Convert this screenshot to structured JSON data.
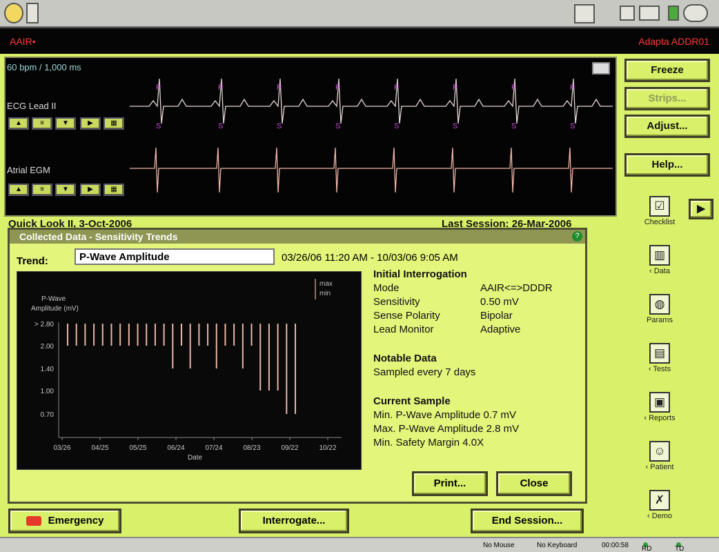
{
  "titlebar": {
    "left": "AAIR•",
    "right": "Adapta ADDR01"
  },
  "ecg": {
    "rate_label": "60 bpm / 1,000 ms",
    "lead1_label": "ECG Lead II",
    "lead2_label": "Atrial EGM",
    "ps_marks": 8
  },
  "controls": {
    "up": "▲",
    "scale": "≡",
    "down": "▼",
    "play": "▶",
    "grid": "▦"
  },
  "side_buttons": {
    "freeze": "Freeze",
    "strips": "Strips...",
    "adjust": "Adjust...",
    "help": "Help..."
  },
  "tools": [
    {
      "label": "Checklist",
      "icon": "checklist-icon",
      "glyph": "☑"
    },
    {
      "label": "‹ Data",
      "icon": "data-icon",
      "glyph": "▥"
    },
    {
      "label": "Params",
      "icon": "params-icon",
      "glyph": "◍"
    },
    {
      "label": "‹ Tests",
      "icon": "tests-icon",
      "glyph": "▤"
    },
    {
      "label": "‹ Reports",
      "icon": "reports-icon",
      "glyph": "▣"
    },
    {
      "label": "‹ Patient",
      "icon": "patient-icon",
      "glyph": "☺"
    },
    {
      "label": "‹ Demo",
      "icon": "demo-icon",
      "glyph": "✗"
    }
  ],
  "arrow_button": "▶",
  "obscured": {
    "left": "Quick Look II, 3-Oct-2006",
    "right": "Last Session: 26-Mar-2006"
  },
  "dialog": {
    "title": "Collected Data - Sensitivity Trends",
    "help": "?",
    "trend_label": "Trend:",
    "trend_value": "P-Wave Amplitude",
    "range": "03/26/06 11:20 AM - 10/03/06 9:05 AM",
    "initial_interrogation": {
      "heading": "Initial Interrogation",
      "rows": [
        {
          "k": "Mode",
          "v": "AAIR<=>DDDR"
        },
        {
          "k": "Sensitivity",
          "v": "0.50 mV"
        },
        {
          "k": "Sense Polarity",
          "v": "Bipolar"
        },
        {
          "k": "Lead Monitor",
          "v": "Adaptive"
        }
      ]
    },
    "notable": {
      "heading": "Notable Data",
      "line": "Sampled every 7 days"
    },
    "current_sample": {
      "heading": "Current Sample",
      "lines": [
        "Min. P-Wave Amplitude 0.7 mV",
        "Max. P-Wave Amplitude 2.8 mV",
        "Min. Safety Margin 4.0X"
      ]
    },
    "print": "Print...",
    "close": "Close"
  },
  "chart_data": {
    "type": "bar",
    "ylabel": "P-Wave\nAmplitude (mV)",
    "xlabel": "Date",
    "legend": [
      "max",
      "min"
    ],
    "yticks": [
      "> 2.80",
      "2.00",
      "1.40",
      "1.00",
      "0.70"
    ],
    "xticks": [
      "03/26",
      "04/25",
      "05/25",
      "06/24",
      "07/24",
      "08/23",
      "09/22",
      "10/22"
    ],
    "series": [
      {
        "name": "max",
        "values": [
          2.8,
          2.8,
          2.8,
          2.8,
          2.8,
          2.8,
          2.8,
          2.8,
          2.8,
          2.8,
          2.8,
          2.8,
          2.8,
          2.8,
          2.8,
          2.8,
          2.8,
          2.8,
          2.8,
          2.8,
          2.8,
          2.8,
          2.8,
          2.8,
          2.8,
          2.8,
          2.8
        ]
      },
      {
        "name": "min",
        "values": [
          2.0,
          2.0,
          2.0,
          2.0,
          2.0,
          2.0,
          2.0,
          2.0,
          2.0,
          2.0,
          2.0,
          2.0,
          1.4,
          2.0,
          1.4,
          2.0,
          2.0,
          1.4,
          2.0,
          2.0,
          1.4,
          2.0,
          1.0,
          1.0,
          1.0,
          0.7,
          0.7
        ]
      }
    ]
  },
  "bottom": {
    "emergency": "Emergency",
    "interrogate": "Interrogate...",
    "end_session": "End Session..."
  },
  "status": {
    "mouse": "No Mouse",
    "keyboard": "No Keyboard",
    "time": "00:00:58",
    "rd": "RD",
    "td": "TD"
  }
}
